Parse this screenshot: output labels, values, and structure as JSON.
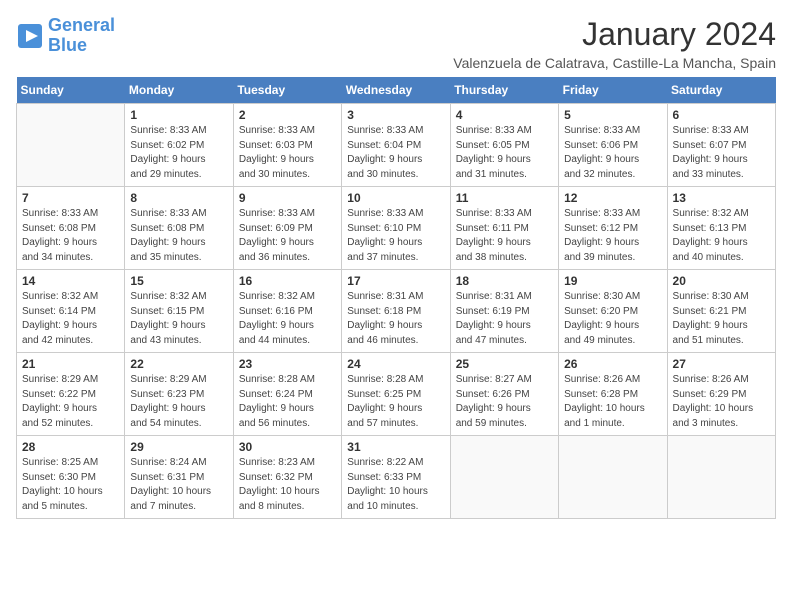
{
  "logo": {
    "line1": "General",
    "line2": "Blue"
  },
  "title": "January 2024",
  "subtitle": "Valenzuela de Calatrava, Castille-La Mancha, Spain",
  "days_of_week": [
    "Sunday",
    "Monday",
    "Tuesday",
    "Wednesday",
    "Thursday",
    "Friday",
    "Saturday"
  ],
  "weeks": [
    [
      {
        "num": "",
        "info": ""
      },
      {
        "num": "1",
        "info": "Sunrise: 8:33 AM\nSunset: 6:02 PM\nDaylight: 9 hours\nand 29 minutes."
      },
      {
        "num": "2",
        "info": "Sunrise: 8:33 AM\nSunset: 6:03 PM\nDaylight: 9 hours\nand 30 minutes."
      },
      {
        "num": "3",
        "info": "Sunrise: 8:33 AM\nSunset: 6:04 PM\nDaylight: 9 hours\nand 30 minutes."
      },
      {
        "num": "4",
        "info": "Sunrise: 8:33 AM\nSunset: 6:05 PM\nDaylight: 9 hours\nand 31 minutes."
      },
      {
        "num": "5",
        "info": "Sunrise: 8:33 AM\nSunset: 6:06 PM\nDaylight: 9 hours\nand 32 minutes."
      },
      {
        "num": "6",
        "info": "Sunrise: 8:33 AM\nSunset: 6:07 PM\nDaylight: 9 hours\nand 33 minutes."
      }
    ],
    [
      {
        "num": "7",
        "info": "Sunrise: 8:33 AM\nSunset: 6:08 PM\nDaylight: 9 hours\nand 34 minutes."
      },
      {
        "num": "8",
        "info": "Sunrise: 8:33 AM\nSunset: 6:08 PM\nDaylight: 9 hours\nand 35 minutes."
      },
      {
        "num": "9",
        "info": "Sunrise: 8:33 AM\nSunset: 6:09 PM\nDaylight: 9 hours\nand 36 minutes."
      },
      {
        "num": "10",
        "info": "Sunrise: 8:33 AM\nSunset: 6:10 PM\nDaylight: 9 hours\nand 37 minutes."
      },
      {
        "num": "11",
        "info": "Sunrise: 8:33 AM\nSunset: 6:11 PM\nDaylight: 9 hours\nand 38 minutes."
      },
      {
        "num": "12",
        "info": "Sunrise: 8:33 AM\nSunset: 6:12 PM\nDaylight: 9 hours\nand 39 minutes."
      },
      {
        "num": "13",
        "info": "Sunrise: 8:32 AM\nSunset: 6:13 PM\nDaylight: 9 hours\nand 40 minutes."
      }
    ],
    [
      {
        "num": "14",
        "info": "Sunrise: 8:32 AM\nSunset: 6:14 PM\nDaylight: 9 hours\nand 42 minutes."
      },
      {
        "num": "15",
        "info": "Sunrise: 8:32 AM\nSunset: 6:15 PM\nDaylight: 9 hours\nand 43 minutes."
      },
      {
        "num": "16",
        "info": "Sunrise: 8:32 AM\nSunset: 6:16 PM\nDaylight: 9 hours\nand 44 minutes."
      },
      {
        "num": "17",
        "info": "Sunrise: 8:31 AM\nSunset: 6:18 PM\nDaylight: 9 hours\nand 46 minutes."
      },
      {
        "num": "18",
        "info": "Sunrise: 8:31 AM\nSunset: 6:19 PM\nDaylight: 9 hours\nand 47 minutes."
      },
      {
        "num": "19",
        "info": "Sunrise: 8:30 AM\nSunset: 6:20 PM\nDaylight: 9 hours\nand 49 minutes."
      },
      {
        "num": "20",
        "info": "Sunrise: 8:30 AM\nSunset: 6:21 PM\nDaylight: 9 hours\nand 51 minutes."
      }
    ],
    [
      {
        "num": "21",
        "info": "Sunrise: 8:29 AM\nSunset: 6:22 PM\nDaylight: 9 hours\nand 52 minutes."
      },
      {
        "num": "22",
        "info": "Sunrise: 8:29 AM\nSunset: 6:23 PM\nDaylight: 9 hours\nand 54 minutes."
      },
      {
        "num": "23",
        "info": "Sunrise: 8:28 AM\nSunset: 6:24 PM\nDaylight: 9 hours\nand 56 minutes."
      },
      {
        "num": "24",
        "info": "Sunrise: 8:28 AM\nSunset: 6:25 PM\nDaylight: 9 hours\nand 57 minutes."
      },
      {
        "num": "25",
        "info": "Sunrise: 8:27 AM\nSunset: 6:26 PM\nDaylight: 9 hours\nand 59 minutes."
      },
      {
        "num": "26",
        "info": "Sunrise: 8:26 AM\nSunset: 6:28 PM\nDaylight: 10 hours\nand 1 minute."
      },
      {
        "num": "27",
        "info": "Sunrise: 8:26 AM\nSunset: 6:29 PM\nDaylight: 10 hours\nand 3 minutes."
      }
    ],
    [
      {
        "num": "28",
        "info": "Sunrise: 8:25 AM\nSunset: 6:30 PM\nDaylight: 10 hours\nand 5 minutes."
      },
      {
        "num": "29",
        "info": "Sunrise: 8:24 AM\nSunset: 6:31 PM\nDaylight: 10 hours\nand 7 minutes."
      },
      {
        "num": "30",
        "info": "Sunrise: 8:23 AM\nSunset: 6:32 PM\nDaylight: 10 hours\nand 8 minutes."
      },
      {
        "num": "31",
        "info": "Sunrise: 8:22 AM\nSunset: 6:33 PM\nDaylight: 10 hours\nand 10 minutes."
      },
      {
        "num": "",
        "info": ""
      },
      {
        "num": "",
        "info": ""
      },
      {
        "num": "",
        "info": ""
      }
    ]
  ]
}
